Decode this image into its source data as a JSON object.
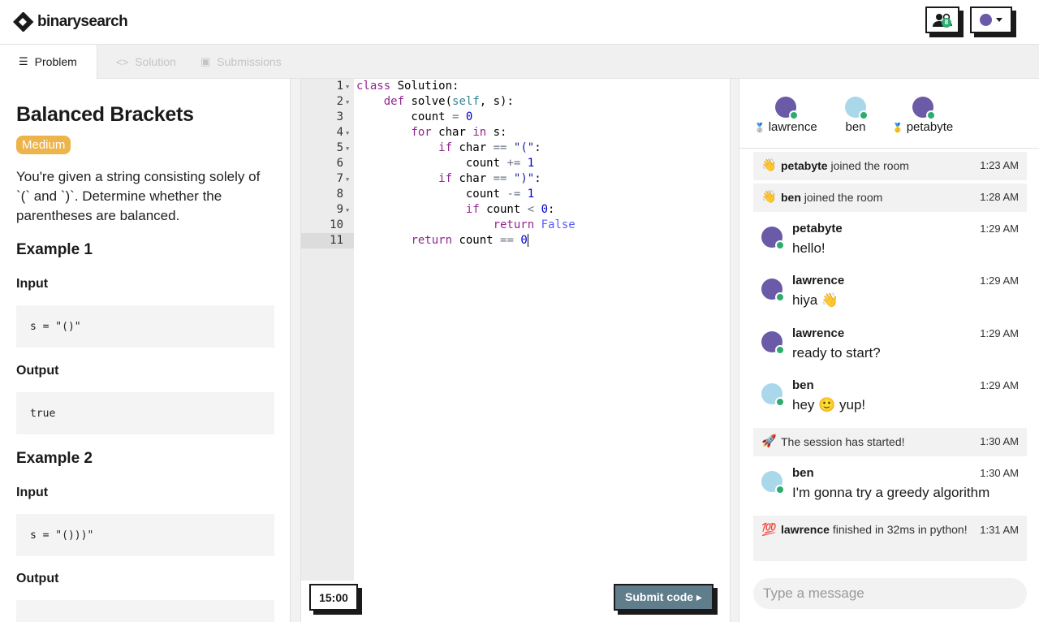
{
  "brand": {
    "name": "binarysearch"
  },
  "topbar": {
    "participants_count": "8"
  },
  "tabs": [
    {
      "label": "Problem"
    },
    {
      "label": "Solution"
    },
    {
      "label": "Submissions"
    }
  ],
  "problem": {
    "title": "Balanced Brackets",
    "difficulty": "Medium",
    "description": "You're given a string consisting solely of `(` and `)`. Determine whether the parentheses are balanced.",
    "examples": [
      {
        "heading": "Example 1",
        "input_label": "Input",
        "input": "s = \"()\"",
        "output_label": "Output",
        "output": "true"
      },
      {
        "heading": "Example 2",
        "input_label": "Input",
        "input": "s = \"()))\"",
        "output_label": "Output",
        "output": ""
      }
    ]
  },
  "editor": {
    "line_numbers": [
      "1",
      "2",
      "3",
      "4",
      "5",
      "6",
      "7",
      "8",
      "9",
      "10",
      "11"
    ],
    "lines": [
      "class Solution:",
      "    def solve(self, s):",
      "        count = 0",
      "        for char in s:",
      "            if char == \"(\":",
      "                count += 1",
      "            if char == \")\":",
      "                count -= 1",
      "                if count < 0:",
      "                    return False",
      "        return count == 0"
    ],
    "current_line": 11,
    "timer": "15:00",
    "submit_label": "Submit code ▸"
  },
  "chat": {
    "members": [
      {
        "name": "lawrence",
        "medal": "🥈",
        "color": "#6b5aa8"
      },
      {
        "name": "ben",
        "medal": "",
        "color": "#a8d8ea"
      },
      {
        "name": "petabyte",
        "medal": "🥇",
        "color": "#6b5aa8"
      }
    ],
    "feed": [
      {
        "kind": "system",
        "emoji": "👋",
        "user": "petabyte",
        "text": " joined the room",
        "time": "1:23 AM"
      },
      {
        "kind": "system",
        "emoji": "👋",
        "user": "ben",
        "text": " joined the room",
        "time": "1:28 AM"
      },
      {
        "kind": "message",
        "user": "petabyte",
        "text": "hello!",
        "time": "1:29 AM",
        "color": "#6b5aa8"
      },
      {
        "kind": "message",
        "user": "lawrence",
        "text": "hiya 👋",
        "time": "1:29 AM",
        "color": "#6b5aa8"
      },
      {
        "kind": "message",
        "user": "lawrence",
        "text": "ready to start?",
        "time": "1:29 AM",
        "color": "#6b5aa8"
      },
      {
        "kind": "message",
        "user": "ben",
        "text": "hey 🙂  yup!",
        "time": "1:29 AM",
        "color": "#a8d8ea"
      },
      {
        "kind": "system",
        "emoji": "🚀",
        "user": "",
        "text": "The session has started!",
        "time": "1:30 AM"
      },
      {
        "kind": "message",
        "user": "ben",
        "text": "I'm gonna try a greedy algorithm",
        "time": "1:30 AM",
        "color": "#a8d8ea"
      },
      {
        "kind": "system",
        "emoji": "💯",
        "user": "lawrence",
        "text": " finished in 32ms in python!",
        "time": "1:31 AM"
      }
    ],
    "input_placeholder": "Type a message"
  }
}
